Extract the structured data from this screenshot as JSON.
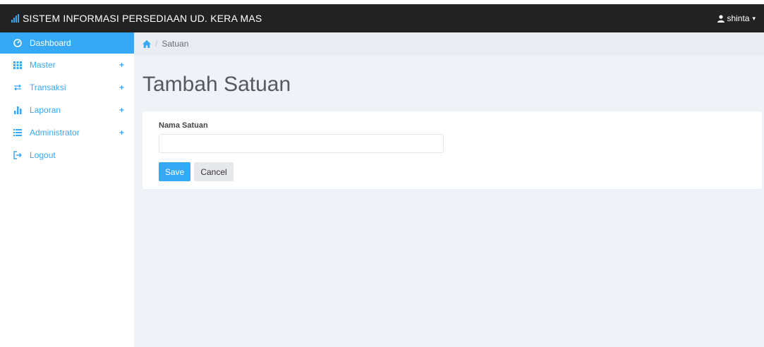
{
  "header": {
    "title": "SISTEM INFORMASI PERSEDIAAN UD. KERA MAS",
    "icon": "signal-bars-icon",
    "user": {
      "name": "shinta",
      "icon": "user-icon",
      "caret": "▾"
    }
  },
  "sidebar": {
    "items": [
      {
        "label": "Dashboard",
        "icon": "dashboard-icon",
        "active": true
      },
      {
        "label": "Master",
        "icon": "grid-icon",
        "expandable": true,
        "expand_glyph": "+"
      },
      {
        "label": "Transaksi",
        "icon": "exchange-icon",
        "expandable": true,
        "expand_glyph": "+"
      },
      {
        "label": "Laporan",
        "icon": "bar-chart-icon",
        "expandable": true,
        "expand_glyph": "+"
      },
      {
        "label": "Administrator",
        "icon": "list-icon",
        "expandable": true,
        "expand_glyph": "+"
      },
      {
        "label": "Logout",
        "icon": "logout-icon"
      }
    ]
  },
  "breadcrumb": {
    "home_icon": "home-icon",
    "separator": "/",
    "current": "Satuan"
  },
  "main": {
    "title": "Tambah Satuan",
    "form": {
      "field_label": "Nama Satuan",
      "field_value": "",
      "field_placeholder": "",
      "save_label": "Save",
      "cancel_label": "Cancel"
    }
  },
  "colors": {
    "accent": "#35a9f6",
    "topbar": "#222222",
    "content_bg": "#eff2f6"
  }
}
